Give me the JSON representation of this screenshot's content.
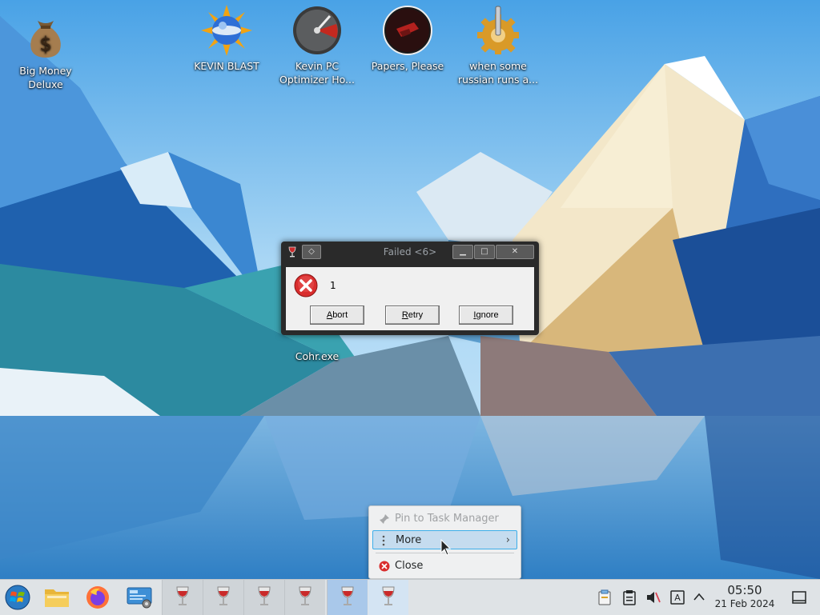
{
  "desktop": {
    "icons": [
      {
        "label": "Big Money Deluxe",
        "icon": "money-bag-icon"
      },
      {
        "label": "KEVIN BLAST",
        "icon": "sun-globe-icon"
      },
      {
        "label": "Kevin PC Optimizer Ho...",
        "icon": "gauge-icon"
      },
      {
        "label": "Papers, Please",
        "icon": "papers-please-icon"
      },
      {
        "label": "when some russian runs a...",
        "icon": "gear-icon"
      },
      {
        "label": "Cohr.exe",
        "icon": "exe-icon"
      }
    ]
  },
  "dialog": {
    "title": "Failed <6>",
    "message": "1",
    "buttons": {
      "abort": "Abort",
      "retry": "Retry",
      "ignore": "Ignore"
    },
    "mnemonics": {
      "abort": "A",
      "retry": "R",
      "ignore": "I"
    },
    "button_rest": {
      "abort": "bort",
      "retry": "etry",
      "ignore": "gnore"
    }
  },
  "context_menu": {
    "items": [
      {
        "label": "Pin to Task Manager",
        "icon": "pin-icon",
        "enabled": false
      },
      {
        "label": "More",
        "icon": "more-icon",
        "enabled": true,
        "submenu": true
      },
      {
        "label": "Close",
        "icon": "close-circle-icon",
        "enabled": true
      }
    ]
  },
  "taskbar": {
    "clock_time": "05:50",
    "clock_date": "21 Feb 2024"
  },
  "colors": {
    "accent": "#3daee9",
    "error_red": "#d92d2d"
  }
}
